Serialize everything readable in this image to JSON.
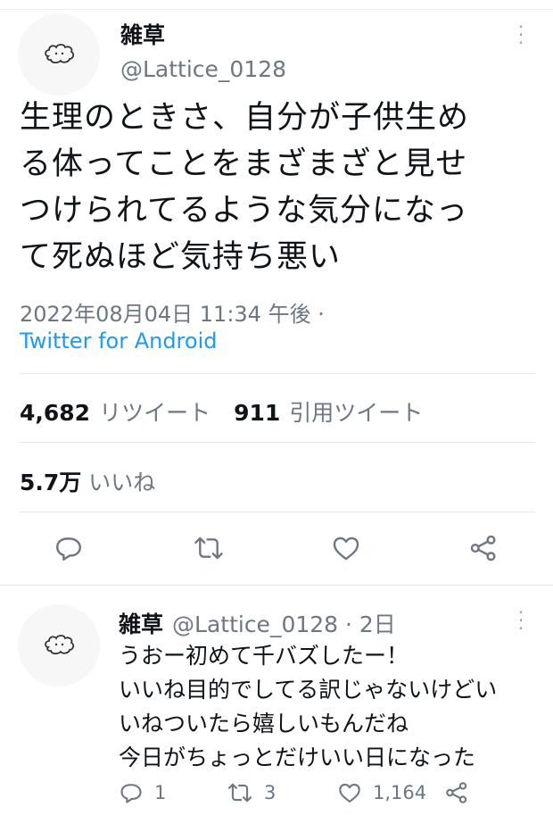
{
  "tweet": {
    "name": "雑草",
    "handle": "@Lattice_0128",
    "text_lines": [
      "生理のときさ、自分が子供生め",
      "る体ってことをまざまざと見せ",
      "つけられてるような気分になっ",
      "て死ぬほど気持ち悪い"
    ],
    "timestamp": "2022年08月04日 11:34 午後 ·",
    "source": "Twitter for Android",
    "stats": {
      "retweets_count": "4,682",
      "retweets_label": "リツイート",
      "quotes_count": "911",
      "quotes_label": "引用ツイート",
      "likes_count": "5.7万",
      "likes_label": "いいね"
    },
    "actions": [
      "reply-icon",
      "retweet-icon",
      "like-icon",
      "share-icon"
    ]
  },
  "reply": {
    "name": "雑草",
    "handle_time": "@Lattice_0128 · 2日",
    "text_lines": [
      "うおー初めて千バズしたー！",
      "いいね目的でしてる訳じゃないけどい",
      "いねついたら嬉しいもんだね",
      "今日がちょっとだけいい日になった"
    ],
    "counts": {
      "replies": "1",
      "retweets": "3",
      "likes": "1,164"
    }
  }
}
